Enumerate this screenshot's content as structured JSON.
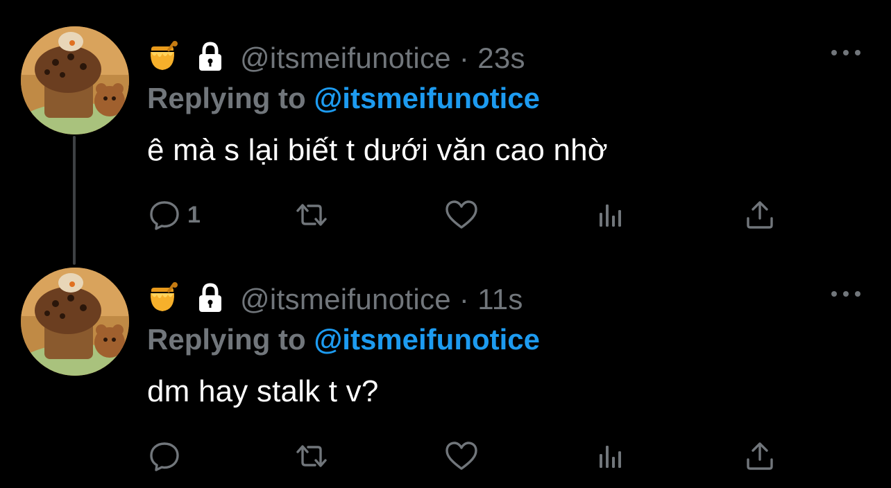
{
  "tweets": [
    {
      "handle": "@itsmeifunotice",
      "separator": "·",
      "time": "23s",
      "replying_label": "Replying to ",
      "replying_to": "@itsmeifunotice",
      "text": "ê mà s lại biết t dưới văn cao nhờ",
      "reply_count": "1",
      "icons": {
        "badge": "honey-pot-icon",
        "protected": "lock-icon",
        "more": "more-icon",
        "reply": "reply-icon",
        "retweet": "retweet-icon",
        "like": "heart-icon",
        "views": "analytics-icon",
        "share": "share-icon"
      }
    },
    {
      "handle": "@itsmeifunotice",
      "separator": "·",
      "time": "11s",
      "replying_label": "Replying to ",
      "replying_to": "@itsmeifunotice",
      "text": "dm hay stalk t v?",
      "reply_count": "",
      "icons": {
        "badge": "honey-pot-icon",
        "protected": "lock-icon",
        "more": "more-icon",
        "reply": "reply-icon",
        "retweet": "retweet-icon",
        "like": "heart-icon",
        "views": "analytics-icon",
        "share": "share-icon"
      }
    }
  ],
  "colors": {
    "background": "#000000",
    "secondary_text": "#71767b",
    "accent": "#1d9bf0",
    "thread_line": "#3e4144"
  }
}
